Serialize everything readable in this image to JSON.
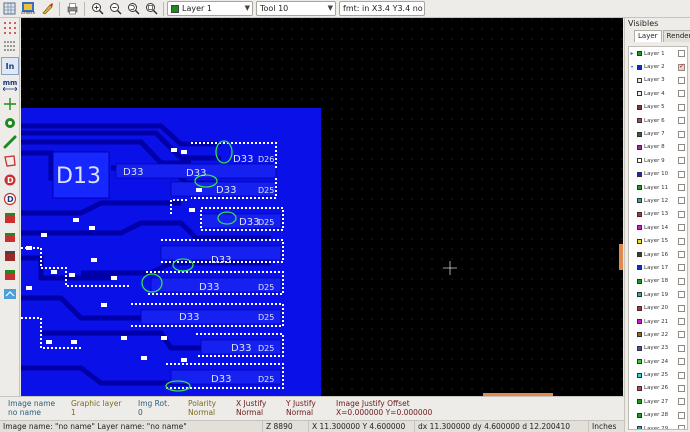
{
  "toolbar": {
    "icons": [
      "grid-icon",
      "gerber-icon",
      "edit-icon",
      "print-icon",
      "zoom-in-icon",
      "zoom-out-icon",
      "zoom-fit-icon",
      "zoom-area-icon"
    ],
    "gerber_label": "GERBER",
    "layer_combo": {
      "value": "Layer 1",
      "swatch_color": "#1e8a1e"
    },
    "tool_combo": {
      "value": "Tool 10"
    },
    "fmt_field": {
      "value": "fmt: in X3.4 Y3.4 no LZ"
    }
  },
  "left_tools": [
    "grid-dots-icon",
    "polar-grid-icon",
    "inch-units-icon",
    "mm-units-icon",
    "full-cursor-icon",
    "show-flashed-icon",
    "show-lines-icon",
    "show-polygons-icon",
    "show-dcodes-icon",
    "show-negative-icon",
    "display-mode-icon",
    "layers-tree-icon",
    "layers-sort-icon",
    "layers-stack-icon",
    "manager-icon"
  ],
  "left_tool_labels": {
    "inch": "In",
    "mm": "mm"
  },
  "canvas": {
    "labels": [
      "D13",
      "D33",
      "D33",
      "D33",
      "D33",
      "D33",
      "D33",
      "D33",
      "D33",
      "D33",
      "D33",
      "D26",
      "D25",
      "D25",
      "D25",
      "D25",
      "D25",
      "D25"
    ]
  },
  "visibles": {
    "title": "Visibles",
    "tabs": [
      "Layer",
      "Render"
    ],
    "layers": [
      {
        "name": "Layer 1",
        "color": "#1e9a1e",
        "checked": false,
        "marker": "▸"
      },
      {
        "name": "Layer 2",
        "color": "#1428c8",
        "checked": true,
        "marker": "•"
      },
      {
        "name": "Layer 3",
        "color": "#e8e8e8",
        "checked": false,
        "marker": ""
      },
      {
        "name": "Layer 4",
        "color": "#eeeeee",
        "checked": false,
        "marker": ""
      },
      {
        "name": "Layer 5",
        "color": "#8a3030",
        "checked": false,
        "marker": ""
      },
      {
        "name": "Layer 6",
        "color": "#a05050",
        "checked": false,
        "marker": ""
      },
      {
        "name": "Layer 7",
        "color": "#2a6a2a",
        "checked": false,
        "marker": ""
      },
      {
        "name": "Layer 8",
        "color": "#a02ca0",
        "checked": false,
        "marker": ""
      },
      {
        "name": "Layer 9",
        "color": "#ffffff",
        "checked": false,
        "marker": ""
      },
      {
        "name": "Layer 10",
        "color": "#1428c8",
        "checked": false,
        "marker": ""
      },
      {
        "name": "Layer 11",
        "color": "#1e9a1e",
        "checked": false,
        "marker": ""
      },
      {
        "name": "Layer 12",
        "color": "#20b0b0",
        "checked": false,
        "marker": ""
      },
      {
        "name": "Layer 13",
        "color": "#c82828",
        "checked": false,
        "marker": ""
      },
      {
        "name": "Layer 14",
        "color": "#c820c8",
        "checked": false,
        "marker": ""
      },
      {
        "name": "Layer 15",
        "color": "#e8e020",
        "checked": false,
        "marker": ""
      },
      {
        "name": "Layer 16",
        "color": "#3c3c3c",
        "checked": false,
        "marker": ""
      },
      {
        "name": "Layer 17",
        "color": "#1428c8",
        "checked": false,
        "marker": ""
      },
      {
        "name": "Layer 18",
        "color": "#1e9a1e",
        "checked": false,
        "marker": ""
      },
      {
        "name": "Layer 19",
        "color": "#20b0b0",
        "checked": false,
        "marker": ""
      },
      {
        "name": "Layer 20",
        "color": "#c82828",
        "checked": false,
        "marker": ""
      },
      {
        "name": "Layer 21",
        "color": "#c820c8",
        "checked": false,
        "marker": ""
      },
      {
        "name": "Layer 22",
        "color": "#a06020",
        "checked": false,
        "marker": ""
      },
      {
        "name": "Layer 23",
        "color": "#3c50c8",
        "checked": false,
        "marker": ""
      },
      {
        "name": "Layer 24",
        "color": "#3cc83c",
        "checked": false,
        "marker": ""
      },
      {
        "name": "Layer 25",
        "color": "#40d0d0",
        "checked": false,
        "marker": ""
      },
      {
        "name": "Layer 26",
        "color": "#d04040",
        "checked": false,
        "marker": ""
      },
      {
        "name": "Layer 27",
        "color": "#1e9a1e",
        "checked": false,
        "marker": ""
      },
      {
        "name": "Layer 28",
        "color": "#1e9a1e",
        "checked": false,
        "marker": ""
      },
      {
        "name": "Layer 29",
        "color": "#20b0b0",
        "checked": false,
        "marker": ""
      }
    ]
  },
  "info": {
    "image_name": {
      "label": "Image name",
      "value": "no name"
    },
    "graphic_layer": {
      "label": "Graphic layer",
      "value": "1"
    },
    "img_rot": {
      "label": "Img Rot.",
      "value": "0"
    },
    "polarity": {
      "label": "Polarity",
      "value": "Normal"
    },
    "x_justify": {
      "label": "X Justify",
      "value": "Normal"
    },
    "y_justify": {
      "label": "Y Justify",
      "value": "Normal"
    },
    "image_justify_offset": {
      "label": "Image Justify Offset",
      "value": "X=0.000000 Y=0.000000"
    }
  },
  "status": {
    "message": "Image name: \"no name\"  Layer name: \"no name\"",
    "zoom": "Z 8890",
    "abs": "X 11.300000  Y 4.600000",
    "rel": "dx 11.300000  dy 4.600000  d 12.200410",
    "units": "Inches"
  },
  "colors": {
    "board": "#0a10e8",
    "canvas": "#000000",
    "pads": "#ffffff",
    "highlight": "#33dd55"
  }
}
